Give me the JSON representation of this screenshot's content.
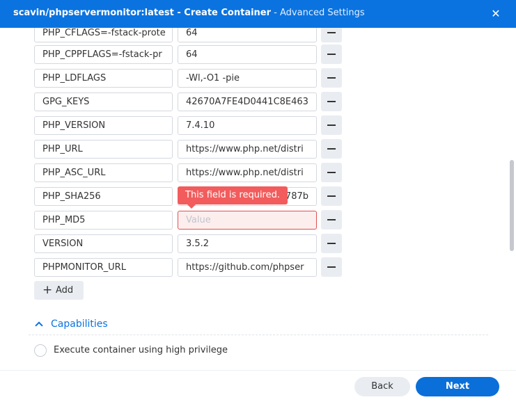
{
  "window": {
    "title_bold": "scavin/phpservermonitor:latest - Create Container",
    "title_rest": " - Advanced Settings",
    "close_glyph": "✕"
  },
  "env_rows": [
    {
      "key": "PHP_CFLAGS=-fstack-prote",
      "value": "64"
    },
    {
      "key": "PHP_CPPFLAGS=-fstack-pr",
      "value": "64"
    },
    {
      "key": "PHP_LDFLAGS",
      "value": "-Wl,-O1 -pie"
    },
    {
      "key": "GPG_KEYS",
      "value": "42670A7FE4D0441C8E463"
    },
    {
      "key": "PHP_VERSION",
      "value": "7.4.10"
    },
    {
      "key": "PHP_URL",
      "value": "https://www.php.net/distri"
    },
    {
      "key": "PHP_ASC_URL",
      "value": "https://www.php.net/distri"
    },
    {
      "key": "PHP_SHA256",
      "value": "787b"
    },
    {
      "key": "PHP_MD5",
      "value": "",
      "placeholder": "Value"
    },
    {
      "key": "VERSION",
      "value": "3.5.2"
    },
    {
      "key": "PHPMONITOR_URL",
      "value": "https://github.com/phpser"
    }
  ],
  "error_tooltip": "This field is required.",
  "add_button": {
    "icon": "+",
    "label": "Add"
  },
  "capabilities": {
    "heading": "Capabilities",
    "privilege_option": "Execute container using high privilege"
  },
  "footer": {
    "back_label": "Back",
    "next_label": "Next"
  },
  "colors": {
    "accent": "#0a73e0",
    "error": "#f25c5c"
  }
}
